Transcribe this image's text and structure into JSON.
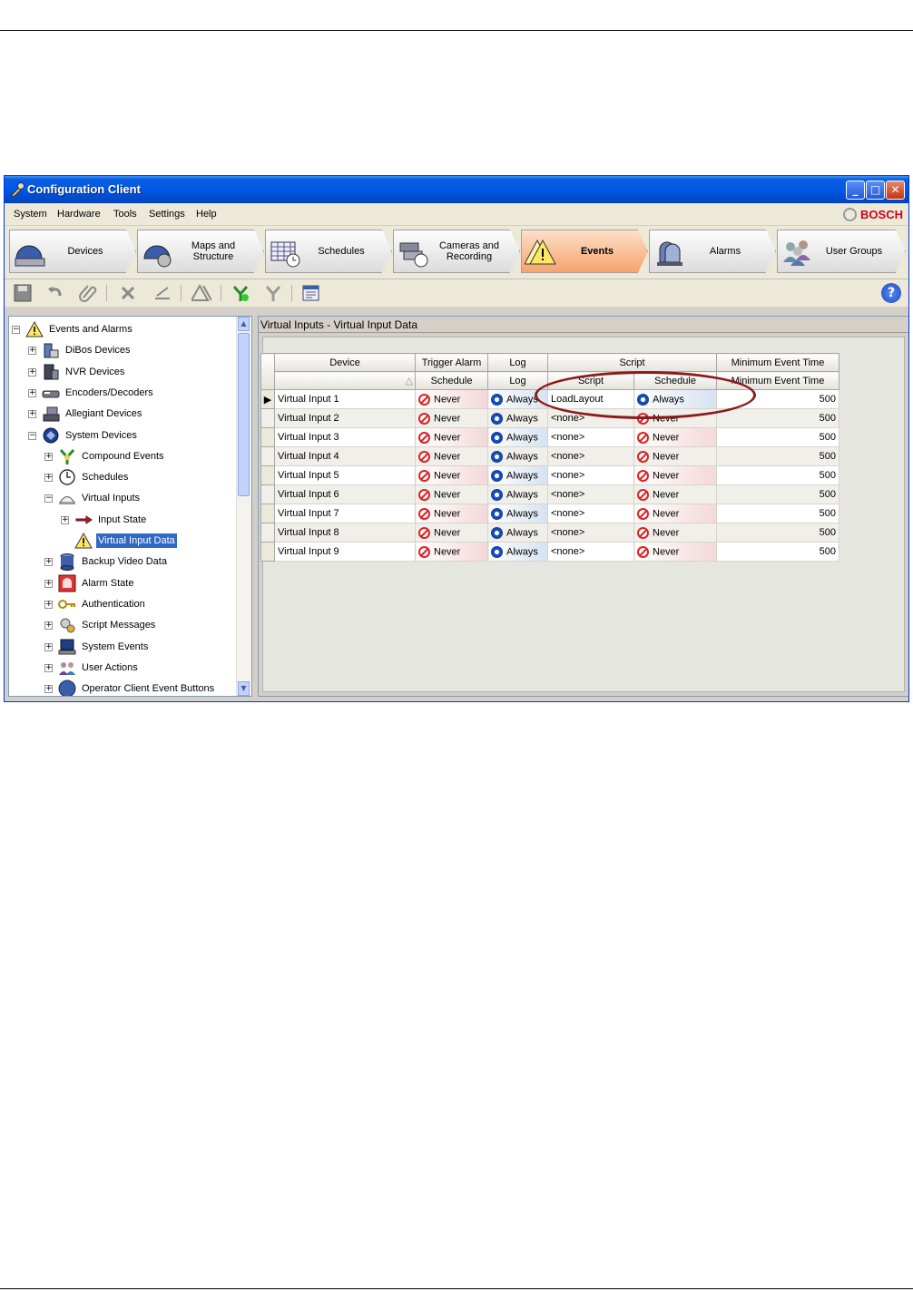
{
  "window": {
    "title": "Configuration Client",
    "brand": "BOSCH"
  },
  "menu": [
    "System",
    "Hardware",
    "Tools",
    "Settings",
    "Help"
  ],
  "nav_tabs": [
    {
      "label": "Devices",
      "icon": "devices-icon"
    },
    {
      "label": "Maps and\nStructure",
      "icon": "maps-icon"
    },
    {
      "label": "Schedules",
      "icon": "schedules-icon"
    },
    {
      "label": "Cameras and\nRecording",
      "icon": "cameras-icon"
    },
    {
      "label": "Events",
      "icon": "events-warning-icon",
      "active": true
    },
    {
      "label": "Alarms",
      "icon": "alarms-icon"
    },
    {
      "label": "User Groups",
      "icon": "user-groups-icon"
    }
  ],
  "tree": {
    "items": [
      {
        "label": "Events and Alarms",
        "icon": "warning-icon",
        "expander": "−"
      },
      {
        "label": "DiBos Devices",
        "icon": "dibos-icon",
        "expander": "+"
      },
      {
        "label": "NVR Devices",
        "icon": "nvr-icon",
        "expander": "+"
      },
      {
        "label": "Encoders/Decoders",
        "icon": "encoder-icon",
        "expander": "+"
      },
      {
        "label": "Allegiant Devices",
        "icon": "allegiant-icon",
        "expander": "+"
      },
      {
        "label": "System Devices",
        "icon": "system-devices-icon",
        "expander": "−"
      },
      {
        "label": "Compound Events",
        "icon": "compound-events-icon",
        "expander": "+"
      },
      {
        "label": "Schedules",
        "icon": "clock-icon",
        "expander": "+"
      },
      {
        "label": "Virtual Inputs",
        "icon": "virtual-inputs-icon",
        "expander": "−"
      },
      {
        "label": "Input State",
        "icon": "arrow-icon",
        "expander": "+"
      },
      {
        "label": "Virtual Input Data",
        "icon": "warning-icon",
        "expander": "",
        "selected": true
      },
      {
        "label": "Backup Video Data",
        "icon": "database-icon",
        "expander": "+"
      },
      {
        "label": "Alarm State",
        "icon": "alarm-state-icon",
        "expander": "+"
      },
      {
        "label": "Authentication",
        "icon": "key-icon",
        "expander": "+"
      },
      {
        "label": "Script Messages",
        "icon": "script-icon",
        "expander": "+"
      },
      {
        "label": "System Events",
        "icon": "computer-icon",
        "expander": "+"
      },
      {
        "label": "User Actions",
        "icon": "users-icon",
        "expander": "+"
      },
      {
        "label": "Operator Client Event Buttons",
        "icon": "circle-button-icon",
        "expander": "+"
      }
    ]
  },
  "pane": {
    "title": "Virtual Inputs - Virtual Input Data"
  },
  "grid": {
    "group_headers": [
      "Device",
      "Trigger Alarm",
      "Log",
      "Script",
      "Minimum Event Time"
    ],
    "sub_headers": [
      "",
      "Schedule",
      "Log",
      "Script",
      "Schedule",
      "Minimum Event Time"
    ],
    "sort_indicator": "△",
    "rows": [
      {
        "device": "Virtual Input 1",
        "alarm": "Never",
        "log": "Always",
        "script": "LoadLayout",
        "schedule": "Always",
        "min_time": "500",
        "current": true
      },
      {
        "device": "Virtual Input 2",
        "alarm": "Never",
        "log": "Always",
        "script": "<none>",
        "schedule": "Never",
        "min_time": "500"
      },
      {
        "device": "Virtual Input 3",
        "alarm": "Never",
        "log": "Always",
        "script": "<none>",
        "schedule": "Never",
        "min_time": "500"
      },
      {
        "device": "Virtual Input 4",
        "alarm": "Never",
        "log": "Always",
        "script": "<none>",
        "schedule": "Never",
        "min_time": "500"
      },
      {
        "device": "Virtual Input 5",
        "alarm": "Never",
        "log": "Always",
        "script": "<none>",
        "schedule": "Never",
        "min_time": "500"
      },
      {
        "device": "Virtual Input 6",
        "alarm": "Never",
        "log": "Always",
        "script": "<none>",
        "schedule": "Never",
        "min_time": "500"
      },
      {
        "device": "Virtual Input 7",
        "alarm": "Never",
        "log": "Always",
        "script": "<none>",
        "schedule": "Never",
        "min_time": "500"
      },
      {
        "device": "Virtual Input 8",
        "alarm": "Never",
        "log": "Always",
        "script": "<none>",
        "schedule": "Never",
        "min_time": "500"
      },
      {
        "device": "Virtual Input 9",
        "alarm": "Never",
        "log": "Always",
        "script": "<none>",
        "schedule": "Never",
        "min_time": "500"
      }
    ]
  },
  "colors": {
    "titlebar": "#0058e6",
    "annotation_ellipse": "#8b1a1a",
    "selection": "#316ac5",
    "never": "#dd2222",
    "always": "#1a56c8"
  }
}
